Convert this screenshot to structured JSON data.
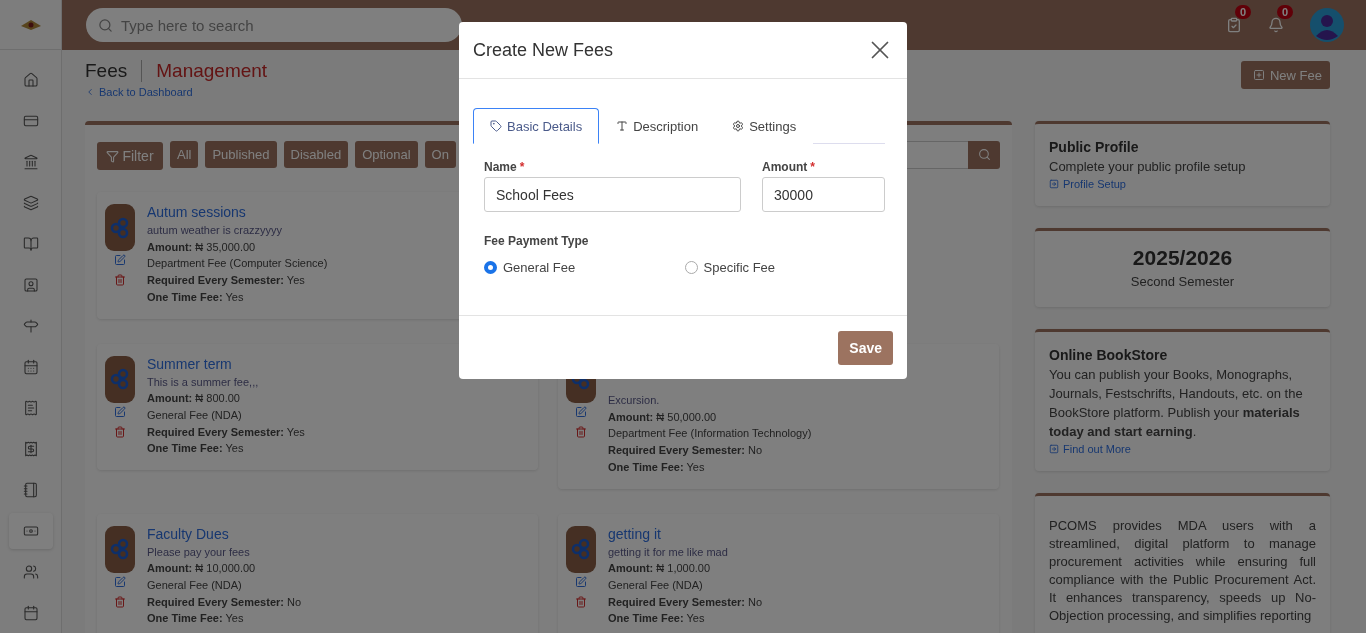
{
  "topbar": {
    "search": {
      "placeholder": "Type here to search"
    },
    "badges": [
      {
        "kind": "tasks",
        "count": "0"
      },
      {
        "kind": "notifications",
        "count": "0"
      }
    ]
  },
  "sidebar": {
    "items": [
      {
        "selected": false
      },
      {
        "selected": false
      },
      {
        "selected": false
      },
      {
        "selected": false
      },
      {
        "selected": false
      },
      {
        "selected": false
      },
      {
        "selected": false
      },
      {
        "selected": false
      },
      {
        "selected": false
      },
      {
        "selected": false
      },
      {
        "selected": false
      },
      {
        "selected": true
      },
      {
        "selected": false
      },
      {
        "selected": false
      }
    ]
  },
  "header": {
    "title": "Fees",
    "subtitle": "Management",
    "back_link": "Back to Dashboard",
    "new_button": "New Fee"
  },
  "filters": {
    "button": "Filter",
    "chips": [
      "All",
      "Published",
      "Disabled",
      "Optional",
      "On"
    ]
  },
  "left_column": [
    {
      "title": "Autum sessions",
      "description": "autum weather is crazzyyyy",
      "lines": [
        "**Amount:** ₦ 35,000.00",
        "Department Fee (Computer Science)",
        "**Required Every Semester:** Yes",
        "**One Time Fee:** Yes"
      ]
    },
    {
      "title": "Summer term",
      "description": "This is a summer fee,,,",
      "lines": [
        "**Amount:** ₦ 800.00",
        "General Fee (NDA)",
        "**Required Every Semester:** Yes",
        "**One Time Fee:** Yes"
      ]
    },
    {
      "title": "Faculty Dues",
      "description": "Please pay your fees",
      "lines": [
        "**Amount:** ₦ 10,000.00",
        "General Fee (NDA)",
        "**Required Every Semester:** No",
        "**One Time Fee:** Yes"
      ]
    }
  ],
  "right_column": [
    {
      "description": "Excursion.",
      "lines": [
        "**Amount:** ₦ 50,000.00",
        "Department Fee (Information Technology)",
        "**Required Every Semester:** No",
        "**One Time Fee:** Yes"
      ]
    },
    {
      "title": "getting it",
      "description": "getting it for me like mad",
      "lines": [
        "**Amount:** ₦ 1,000.00",
        "General Fee (NDA)",
        "**Required Every Semester:** No",
        "**One Time Fee:** Yes"
      ]
    }
  ],
  "aside": {
    "profile": {
      "title": "Public Profile",
      "text": "Complete your public profile setup",
      "link": "Profile Setup"
    },
    "session": {
      "year": "2025/2026",
      "semester": "Second Semester"
    },
    "bookstore": {
      "title": "Online BookStore",
      "text": "You can publish your Books, Monographs, Journals, Festschrifts, Handouts, etc. on the BookStore platform. Publish your **materials today and start earning**.",
      "link": "Find out More"
    },
    "about": {
      "text": "PCOMS provides MDA users with a streamlined, digital platform to manage procurement activities while ensuring full compliance with the Public Procurement Act. It enhances transparency, speeds up No-Objection processing, and simplifies reporting"
    }
  },
  "modal": {
    "title": "Create New Fees",
    "tabs": [
      {
        "label": "Basic Details",
        "selected": true
      },
      {
        "label": "Description",
        "selected": false
      },
      {
        "label": "Settings",
        "selected": false
      }
    ],
    "fields": [
      {
        "label": "Name",
        "marker": "*",
        "value": "School Fees"
      },
      {
        "label": "Amount",
        "marker": "*",
        "value": "30000"
      }
    ],
    "payment_type": {
      "label": "Fee Payment Type",
      "options": [
        {
          "label": "General Fee",
          "selected": true
        },
        {
          "label": "Specific Fee",
          "selected": false
        }
      ]
    },
    "save_button": "Save"
  }
}
